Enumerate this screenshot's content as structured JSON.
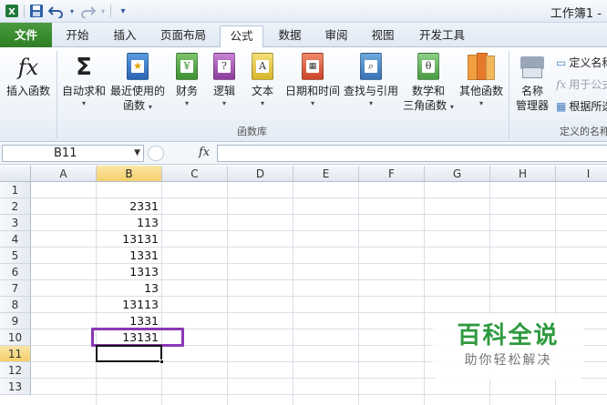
{
  "window": {
    "title": "工作簿1 -"
  },
  "tabs": [
    {
      "label": "文件"
    },
    {
      "label": "开始"
    },
    {
      "label": "插入"
    },
    {
      "label": "页面布局"
    },
    {
      "label": "公式"
    },
    {
      "label": "数据"
    },
    {
      "label": "审阅"
    },
    {
      "label": "视图"
    },
    {
      "label": "开发工具"
    }
  ],
  "ribbon": {
    "insert_function": "插入函数",
    "fx_symbol": "fx",
    "sigma_symbol": "Σ",
    "autosum": "自动求和",
    "recent_line1": "最近使用的",
    "recent_line2": "函数",
    "financial": "财务",
    "logical": "逻辑",
    "text": "文本",
    "datetime": "日期和时间",
    "lookup": "查找与引用",
    "math_line1": "数学和",
    "math_line2": "三角函数",
    "more": "其他函数",
    "library_label": "函数库",
    "name_manager_line1": "名称",
    "name_manager_line2": "管理器",
    "define_name": "定义名称",
    "use_in_formula": "用于公式",
    "create_from_selection": "根据所选",
    "defined_names_label": "定义的名称",
    "caret": "▾"
  },
  "formula_bar": {
    "name_box": "B11",
    "fx_label": "fx",
    "formula": ""
  },
  "grid": {
    "columns": [
      "A",
      "B",
      "C",
      "D",
      "E",
      "F",
      "G",
      "H",
      "I"
    ],
    "rows": [
      "1",
      "2",
      "3",
      "4",
      "5",
      "6",
      "7",
      "8",
      "9",
      "10",
      "11",
      "12",
      "13"
    ],
    "b_values": [
      "",
      "2331",
      "113",
      "13131",
      "1331",
      "1313",
      "13",
      "13113",
      "1331",
      "13131",
      "",
      "",
      ""
    ],
    "selected_column": "B",
    "selected_row": "11",
    "highlight_color": "#8a37b5"
  },
  "watermark": {
    "title": "百科全说",
    "subtitle": "助你轻松解决"
  },
  "colors": {
    "file_tab": "#2f7e25",
    "selection_header": "#f5cf6b"
  }
}
